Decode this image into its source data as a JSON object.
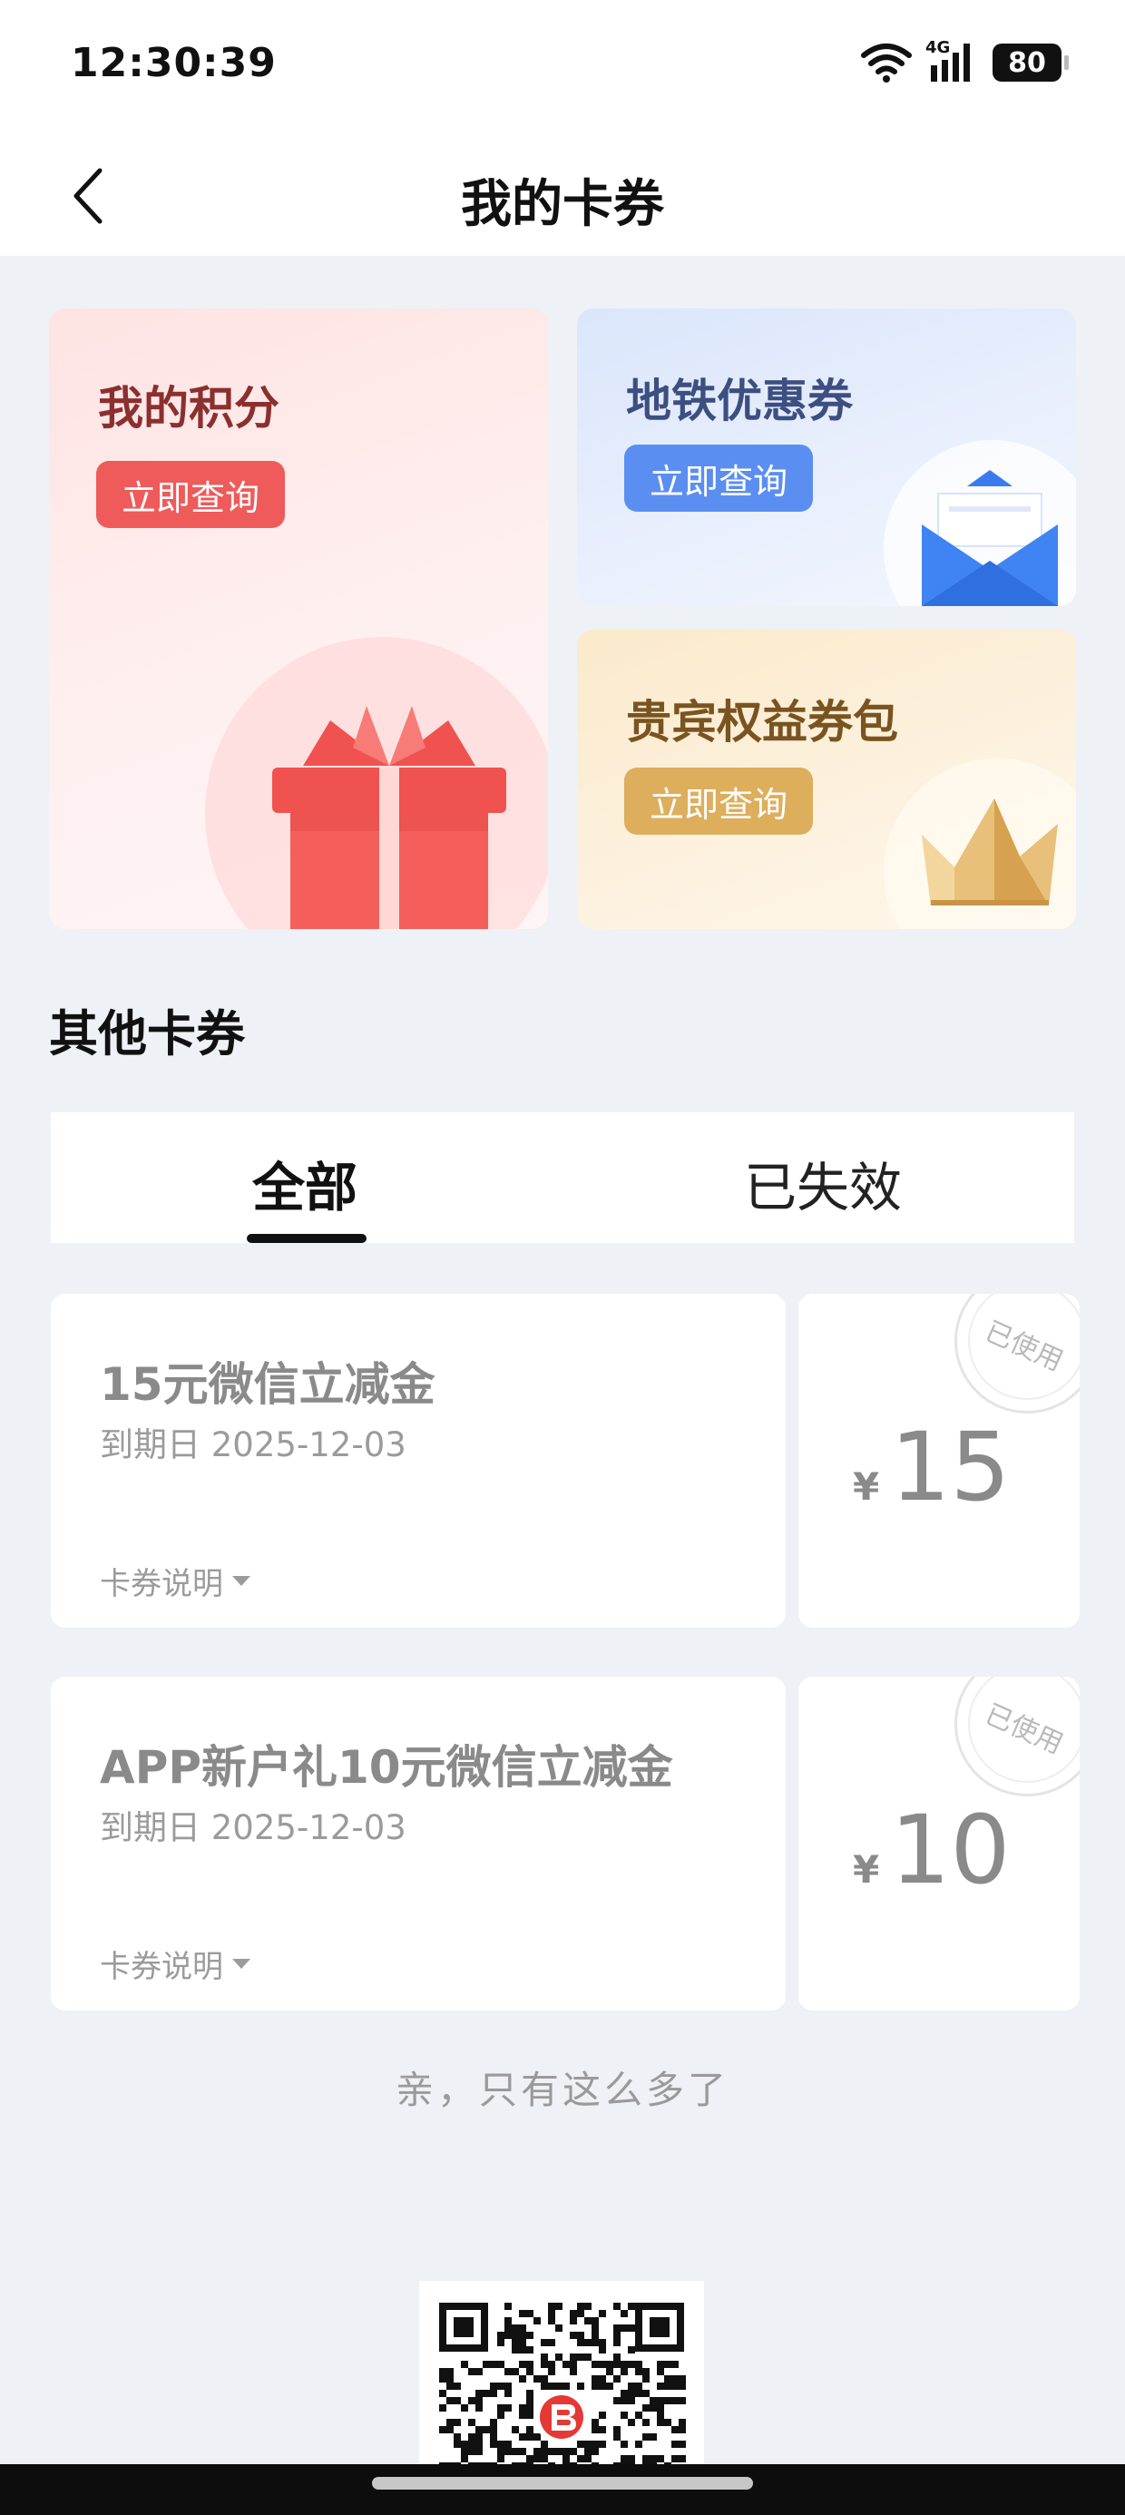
{
  "status_bar": {
    "time": "12:30:39",
    "network": "4G",
    "battery": "80"
  },
  "nav": {
    "title": "我的卡券"
  },
  "promos": {
    "points": {
      "title": "我的积分",
      "button": "立即查询",
      "icon": "gift-icon"
    },
    "metro": {
      "title": "地铁优惠券",
      "button": "立即查询",
      "icon": "envelope-icon"
    },
    "vip": {
      "title": "贵宾权益券包",
      "button": "立即查询",
      "icon": "crown-icon"
    }
  },
  "section": {
    "title": "其他卡券"
  },
  "tabs": [
    {
      "label": "全部",
      "active": true
    },
    {
      "label": "已失效",
      "active": false
    }
  ],
  "coupons": [
    {
      "name": "15元微信立减金",
      "expiry": "到期日 2025-12-03",
      "desc_label": "卡券说明",
      "currency": "¥",
      "amount": "15",
      "stamp": "已使用"
    },
    {
      "name": "APP新户礼10元微信立减金",
      "expiry": "到期日 2025-12-03",
      "desc_label": "卡券说明",
      "currency": "¥",
      "amount": "10",
      "stamp": "已使用"
    }
  ],
  "footer": {
    "end_text": "亲，只有这么多了"
  },
  "colors": {
    "points_accent": "#ef5a5a",
    "metro_accent": "#5b8ef1",
    "vip_accent": "#ddae5c",
    "background": "#eef1f6"
  }
}
